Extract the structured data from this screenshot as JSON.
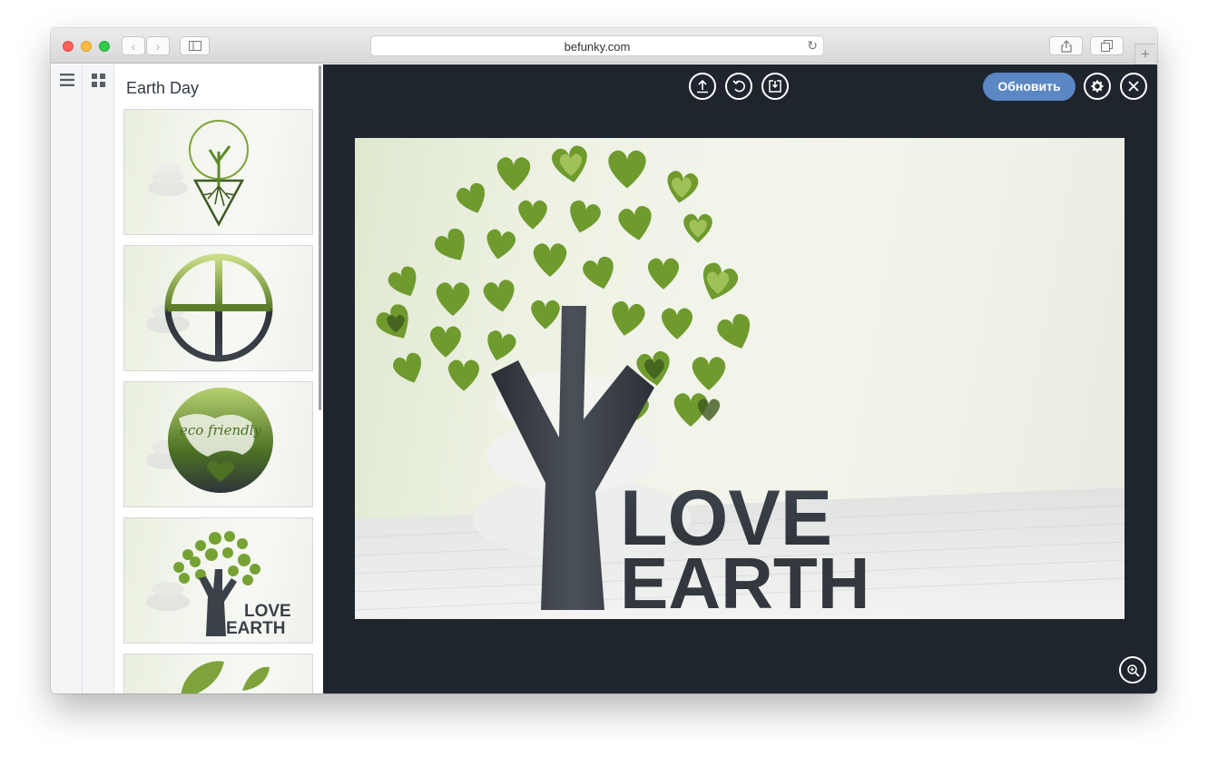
{
  "browser": {
    "url": "befunky.com",
    "toolbar_icons": [
      "back-icon",
      "forward-icon",
      "sidebar-toggle-icon",
      "reload-icon",
      "share-icon",
      "tabs-overview-icon",
      "new-tab-icon"
    ],
    "new_tab_label": "+"
  },
  "app": {
    "rail_icons": [
      "menu-icon",
      "grid-icon"
    ],
    "panel": {
      "title": "Earth Day",
      "thumbnails": [
        {
          "name": "tree-triangle-design"
        },
        {
          "name": "circle-cross-design"
        },
        {
          "name": "eco-friendly-globe-design",
          "caption": "eco friendly"
        },
        {
          "name": "love-earth-tree-design",
          "line1": "LOVE",
          "line2": "EARTH"
        },
        {
          "name": "leaf-design"
        }
      ]
    },
    "toolbar": {
      "upload_icon": "upload-icon",
      "undo_icon": "undo-icon",
      "save_icon": "save-icon",
      "update_label": "Обновить",
      "settings_icon": "gear-icon",
      "close_icon": "close-icon",
      "zoom_icon": "zoom-icon"
    },
    "canvas": {
      "line1": "LOVE",
      "line2": "EARTH"
    }
  },
  "colors": {
    "editor_bg": "#1f252d",
    "accent": "#5b87c5",
    "leaf_green": "#6f9a2e"
  }
}
